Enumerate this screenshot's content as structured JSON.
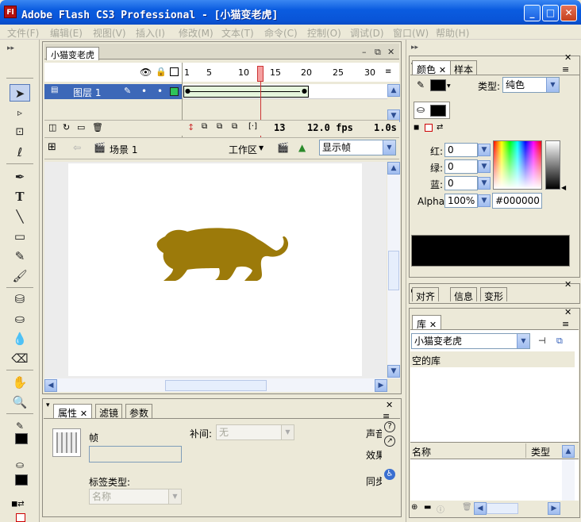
{
  "window": {
    "title": "Adobe Flash CS3 Professional - [小猫变老虎]",
    "app_icon": "Fl"
  },
  "menu": [
    "文件(F)",
    "编辑(E)",
    "视图(V)",
    "插入(I)",
    "修改(M)",
    "文本(T)",
    "命令(C)",
    "控制(O)",
    "调试(D)",
    "窗口(W)",
    "帮助(H)"
  ],
  "document_tab": "小猫变老虎",
  "timeline": {
    "frame_numbers": [
      "1",
      "5",
      "10",
      "15",
      "20",
      "25",
      "30"
    ],
    "layer_name": "图层 1",
    "current_frame": "13",
    "fps": "12.0 fps",
    "time": "1.0s"
  },
  "edit_bar": {
    "scene": "场景 1",
    "workspace": "工作区",
    "view_select": "显示帧"
  },
  "properties": {
    "tabs": [
      "属性",
      "滤镜",
      "参数"
    ],
    "frame_label": "帧",
    "tween_label": "补间:",
    "tween_value": "无",
    "label_type_label": "标签类型:",
    "label_type_value": "名称",
    "sound_label": "声音",
    "effect_label": "效果",
    "sync_label": "同步"
  },
  "color": {
    "tabs": [
      "颜色",
      "样本"
    ],
    "type_label": "类型:",
    "type_value": "纯色",
    "red_label": "红:",
    "red": "0",
    "green_label": "绿:",
    "green": "0",
    "blue_label": "蓝:",
    "blue": "0",
    "alpha_label": "Alpha:",
    "alpha": "100%",
    "hex": "#000000",
    "swatch_color": "#000000"
  },
  "align_tabs": [
    "对齐",
    "信息",
    "变形"
  ],
  "library": {
    "tab": "库",
    "document": "小猫变老虎",
    "empty_text": "空的库",
    "col_name": "名称",
    "col_type": "类型"
  },
  "stage": {
    "tiger_color": "#9c7a0a"
  }
}
